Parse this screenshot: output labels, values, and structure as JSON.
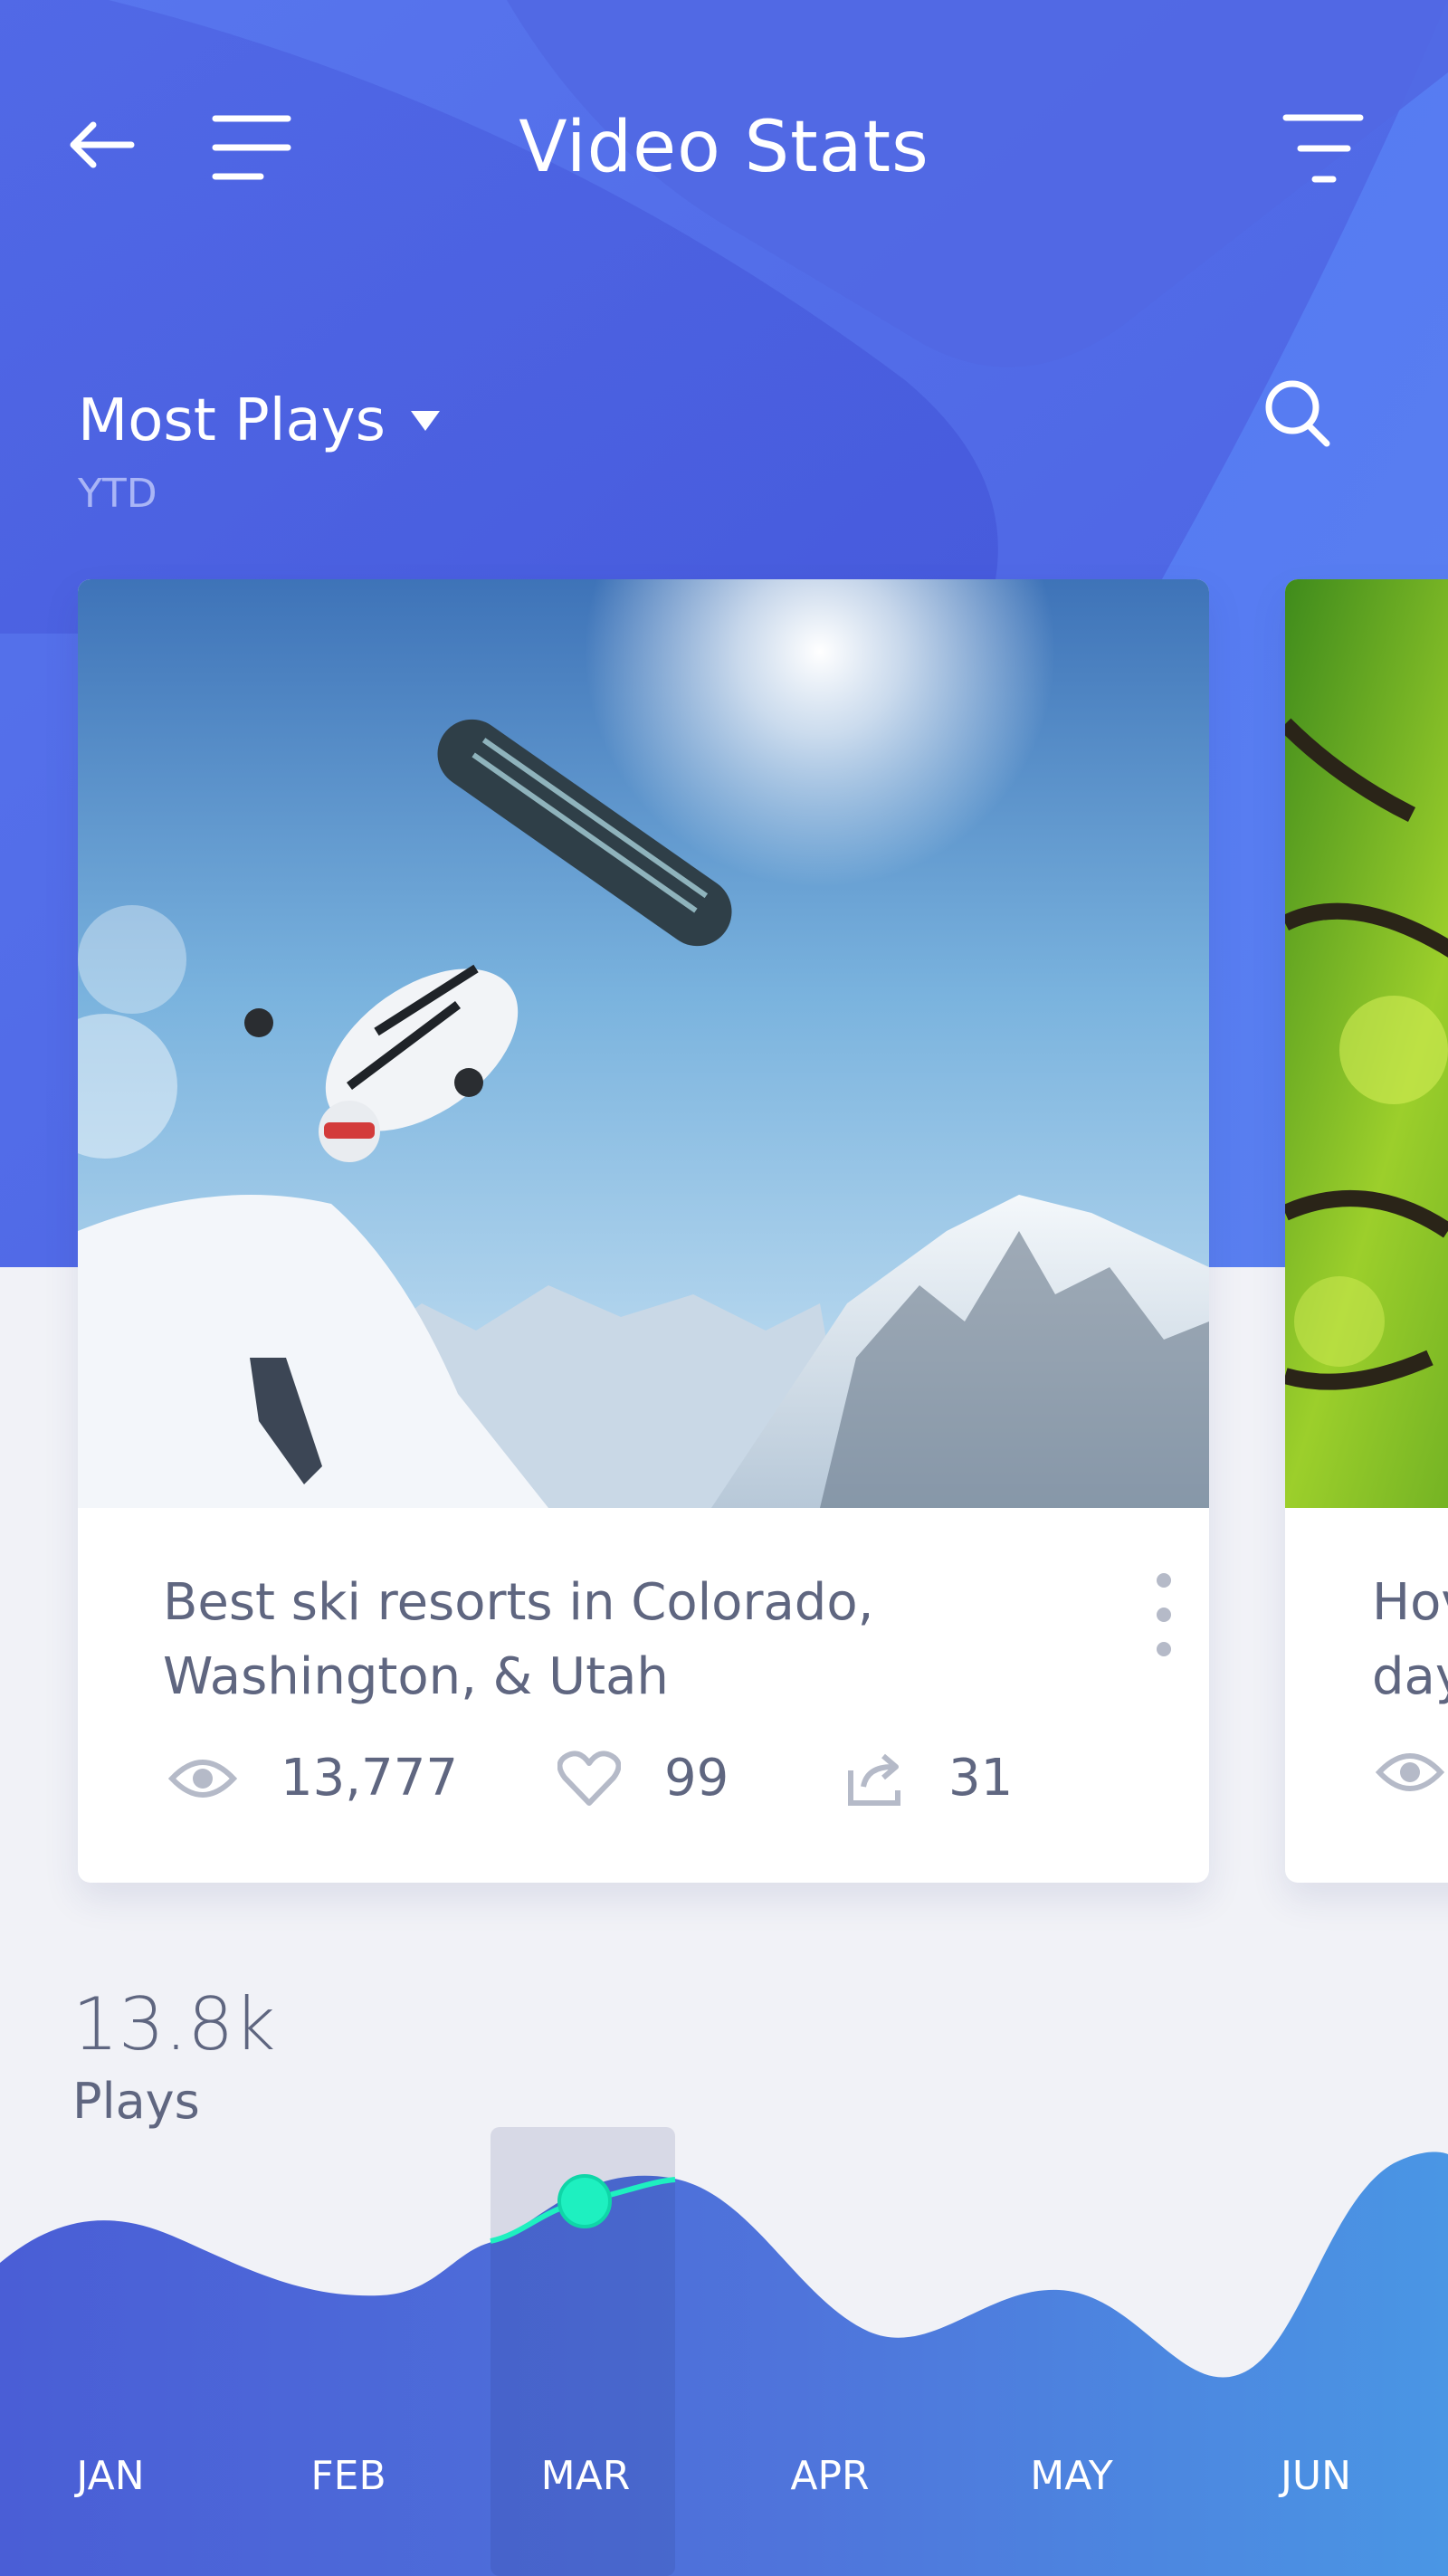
{
  "header": {
    "title": "Video Stats",
    "back_icon": "arrow-left-icon",
    "menu_icon": "hamburger-menu-icon",
    "filter_icon": "filter-icon"
  },
  "sort": {
    "label": "Most Plays",
    "period": "YTD"
  },
  "search_icon": "search-icon",
  "cards": [
    {
      "title_line1": "Best ski resorts in Colorado,",
      "title_line2": "Washington, & Utah",
      "views": "13,777",
      "likes": "99",
      "shares": "31",
      "image": "snowboarder-jump"
    },
    {
      "title_line1": "Hov",
      "title_line2": "day",
      "image": "forest-canopy"
    }
  ],
  "summary": {
    "value": "13.8k",
    "label": "Plays"
  },
  "chart_data": {
    "type": "area",
    "categories": [
      "JAN",
      "FEB",
      "MAR",
      "APR",
      "MAY",
      "JUN"
    ],
    "selected": "MAR"
  },
  "colors": {
    "primary": "#4f6ae8",
    "accent": "#1ef0c0",
    "text": "#5f6680",
    "background": "#f1f2f7"
  }
}
